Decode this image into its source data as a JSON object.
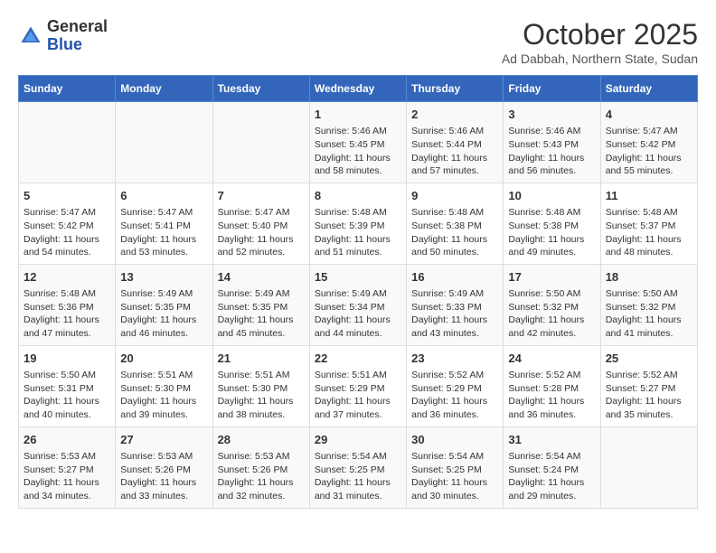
{
  "header": {
    "logo_general": "General",
    "logo_blue": "Blue",
    "month_title": "October 2025",
    "subtitle": "Ad Dabbah, Northern State, Sudan"
  },
  "days_of_week": [
    "Sunday",
    "Monday",
    "Tuesday",
    "Wednesday",
    "Thursday",
    "Friday",
    "Saturday"
  ],
  "weeks": [
    [
      {
        "day": "",
        "info": ""
      },
      {
        "day": "",
        "info": ""
      },
      {
        "day": "",
        "info": ""
      },
      {
        "day": "1",
        "info": "Sunrise: 5:46 AM\nSunset: 5:45 PM\nDaylight: 11 hours\nand 58 minutes."
      },
      {
        "day": "2",
        "info": "Sunrise: 5:46 AM\nSunset: 5:44 PM\nDaylight: 11 hours\nand 57 minutes."
      },
      {
        "day": "3",
        "info": "Sunrise: 5:46 AM\nSunset: 5:43 PM\nDaylight: 11 hours\nand 56 minutes."
      },
      {
        "day": "4",
        "info": "Sunrise: 5:47 AM\nSunset: 5:42 PM\nDaylight: 11 hours\nand 55 minutes."
      }
    ],
    [
      {
        "day": "5",
        "info": "Sunrise: 5:47 AM\nSunset: 5:42 PM\nDaylight: 11 hours\nand 54 minutes."
      },
      {
        "day": "6",
        "info": "Sunrise: 5:47 AM\nSunset: 5:41 PM\nDaylight: 11 hours\nand 53 minutes."
      },
      {
        "day": "7",
        "info": "Sunrise: 5:47 AM\nSunset: 5:40 PM\nDaylight: 11 hours\nand 52 minutes."
      },
      {
        "day": "8",
        "info": "Sunrise: 5:48 AM\nSunset: 5:39 PM\nDaylight: 11 hours\nand 51 minutes."
      },
      {
        "day": "9",
        "info": "Sunrise: 5:48 AM\nSunset: 5:38 PM\nDaylight: 11 hours\nand 50 minutes."
      },
      {
        "day": "10",
        "info": "Sunrise: 5:48 AM\nSunset: 5:38 PM\nDaylight: 11 hours\nand 49 minutes."
      },
      {
        "day": "11",
        "info": "Sunrise: 5:48 AM\nSunset: 5:37 PM\nDaylight: 11 hours\nand 48 minutes."
      }
    ],
    [
      {
        "day": "12",
        "info": "Sunrise: 5:48 AM\nSunset: 5:36 PM\nDaylight: 11 hours\nand 47 minutes."
      },
      {
        "day": "13",
        "info": "Sunrise: 5:49 AM\nSunset: 5:35 PM\nDaylight: 11 hours\nand 46 minutes."
      },
      {
        "day": "14",
        "info": "Sunrise: 5:49 AM\nSunset: 5:35 PM\nDaylight: 11 hours\nand 45 minutes."
      },
      {
        "day": "15",
        "info": "Sunrise: 5:49 AM\nSunset: 5:34 PM\nDaylight: 11 hours\nand 44 minutes."
      },
      {
        "day": "16",
        "info": "Sunrise: 5:49 AM\nSunset: 5:33 PM\nDaylight: 11 hours\nand 43 minutes."
      },
      {
        "day": "17",
        "info": "Sunrise: 5:50 AM\nSunset: 5:32 PM\nDaylight: 11 hours\nand 42 minutes."
      },
      {
        "day": "18",
        "info": "Sunrise: 5:50 AM\nSunset: 5:32 PM\nDaylight: 11 hours\nand 41 minutes."
      }
    ],
    [
      {
        "day": "19",
        "info": "Sunrise: 5:50 AM\nSunset: 5:31 PM\nDaylight: 11 hours\nand 40 minutes."
      },
      {
        "day": "20",
        "info": "Sunrise: 5:51 AM\nSunset: 5:30 PM\nDaylight: 11 hours\nand 39 minutes."
      },
      {
        "day": "21",
        "info": "Sunrise: 5:51 AM\nSunset: 5:30 PM\nDaylight: 11 hours\nand 38 minutes."
      },
      {
        "day": "22",
        "info": "Sunrise: 5:51 AM\nSunset: 5:29 PM\nDaylight: 11 hours\nand 37 minutes."
      },
      {
        "day": "23",
        "info": "Sunrise: 5:52 AM\nSunset: 5:29 PM\nDaylight: 11 hours\nand 36 minutes."
      },
      {
        "day": "24",
        "info": "Sunrise: 5:52 AM\nSunset: 5:28 PM\nDaylight: 11 hours\nand 36 minutes."
      },
      {
        "day": "25",
        "info": "Sunrise: 5:52 AM\nSunset: 5:27 PM\nDaylight: 11 hours\nand 35 minutes."
      }
    ],
    [
      {
        "day": "26",
        "info": "Sunrise: 5:53 AM\nSunset: 5:27 PM\nDaylight: 11 hours\nand 34 minutes."
      },
      {
        "day": "27",
        "info": "Sunrise: 5:53 AM\nSunset: 5:26 PM\nDaylight: 11 hours\nand 33 minutes."
      },
      {
        "day": "28",
        "info": "Sunrise: 5:53 AM\nSunset: 5:26 PM\nDaylight: 11 hours\nand 32 minutes."
      },
      {
        "day": "29",
        "info": "Sunrise: 5:54 AM\nSunset: 5:25 PM\nDaylight: 11 hours\nand 31 minutes."
      },
      {
        "day": "30",
        "info": "Sunrise: 5:54 AM\nSunset: 5:25 PM\nDaylight: 11 hours\nand 30 minutes."
      },
      {
        "day": "31",
        "info": "Sunrise: 5:54 AM\nSunset: 5:24 PM\nDaylight: 11 hours\nand 29 minutes."
      },
      {
        "day": "",
        "info": ""
      }
    ]
  ]
}
